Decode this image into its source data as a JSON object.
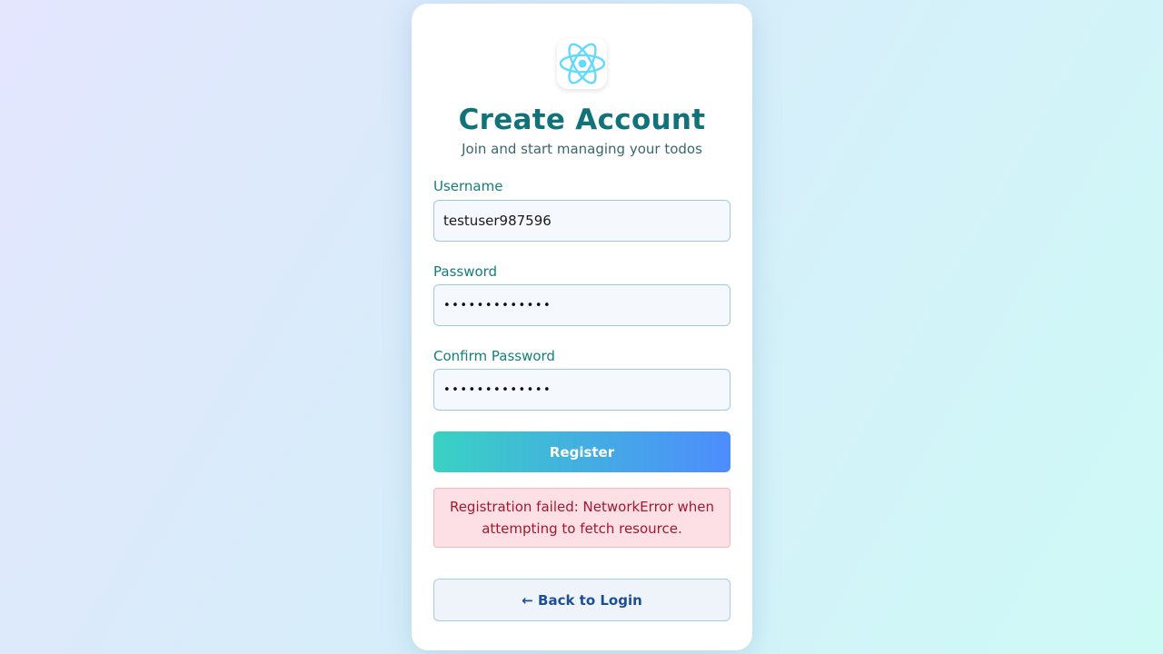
{
  "header": {
    "logo_icon": "react-atom-icon",
    "title": "Create Account",
    "subtitle": "Join and start managing your todos"
  },
  "form": {
    "username": {
      "label": "Username",
      "value": "testuser987596"
    },
    "password": {
      "label": "Password",
      "value": "•••••••••••••"
    },
    "confirm_password": {
      "label": "Confirm Password",
      "value": "•••••••••••••"
    },
    "register_label": "Register",
    "error_message": "Registration failed: NetworkError when attempting to fetch resource.",
    "back_label": "← Back to Login"
  },
  "colors": {
    "accent_start": "#39d2c3",
    "accent_end": "#4d8cfe",
    "title": "#11727a",
    "error_bg": "#fde0e5",
    "error_text": "#a3182c",
    "logo": "#61dafb"
  }
}
